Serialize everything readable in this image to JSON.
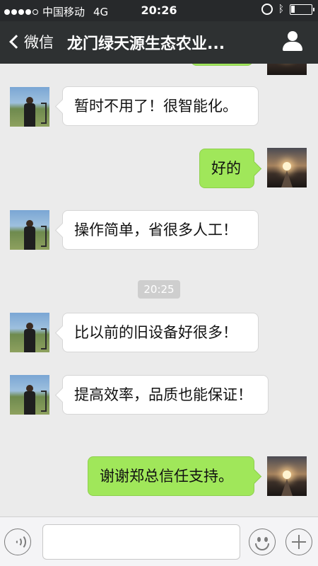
{
  "status_bar": {
    "carrier": "中国移动",
    "network": "4G",
    "time": "20:26",
    "signal_bars": 4,
    "signal_max": 5,
    "battery_level": 0.2
  },
  "nav": {
    "back_label": "微信",
    "title": "龙门绿天源生态农业..."
  },
  "messages": [
    {
      "side": "left",
      "text": "暂时不用了！很智能化。"
    },
    {
      "side": "right",
      "text": "好的"
    },
    {
      "side": "left",
      "text": "操作简单，省很多人工！"
    },
    {
      "side": "left",
      "text": "比以前的旧设备好很多！"
    },
    {
      "side": "left",
      "text": "提高效率，品质也能保证！"
    },
    {
      "side": "right",
      "text": "谢谢郑总信任支持。"
    }
  ],
  "timestamp": "20:25",
  "colors": {
    "nav_bg": "#2e3132",
    "chat_bg": "#ebebeb",
    "sent_bubble": "#a0e75a",
    "received_bubble": "#ffffff"
  },
  "icons": {
    "back": "chevron-left-icon",
    "profile": "person-icon",
    "voice": "voice-icon",
    "emoji": "emoji-icon",
    "more": "plus-icon"
  }
}
